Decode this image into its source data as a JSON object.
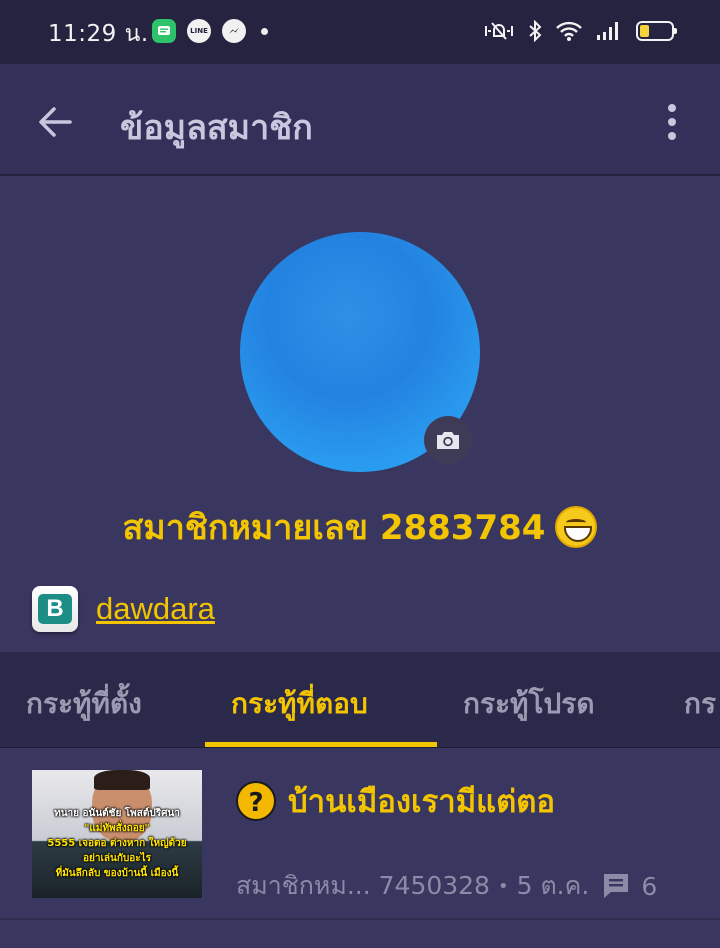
{
  "status_bar": {
    "time": "11:29 น.",
    "apps": [
      "messages-icon",
      "line-icon",
      "messenger-icon",
      "notification-dot"
    ],
    "line_label": "LINE",
    "system_icons": [
      "mute-icon",
      "bluetooth-icon",
      "wifi-icon",
      "signal-icon",
      "battery-icon"
    ],
    "battery_color": "#f4d33c"
  },
  "app_bar": {
    "title": "ข้อมูลสมาชิก",
    "back_icon": "arrow-left-icon",
    "more_icon": "more-vertical-icon"
  },
  "profile": {
    "avatar_color": "#2a8ee8",
    "camera_icon": "camera-icon",
    "member_label": "สมาชิกหมายเลข 2883784",
    "emoji_icon": "grinning-face-icon",
    "badge_letter": "B",
    "username": "dawdara"
  },
  "tabs": {
    "items": [
      {
        "label": "กระทู้ที่ตั้ง",
        "active": false
      },
      {
        "label": "กระทู้ที่ตอบ",
        "active": true
      },
      {
        "label": "กระทู้โปรด",
        "active": false
      },
      {
        "label": "กร",
        "active": false
      }
    ],
    "accent": "#f2c500"
  },
  "topics": [
    {
      "thumbnail_lines": [
        "ทนาย อนันต์ชัย โพสต์ปริศนา",
        "\"แม่ทัพสั่งถอย\"",
        "5555 เจอตอ ต่างหาก ใหญ่ด้วย",
        "อย่าเล่นกับอะไร",
        "ที่มันลึกลับ ของบ้านนี้ เมืองนี้"
      ],
      "type_icon": "question-icon",
      "type_symbol": "?",
      "title": "บ้านเมืองเรามีแต่ตอ",
      "author": "สมาชิกหม... 7450328",
      "date": "5 ต.ค.",
      "comment_icon": "comment-icon",
      "comment_count": "6"
    }
  ]
}
